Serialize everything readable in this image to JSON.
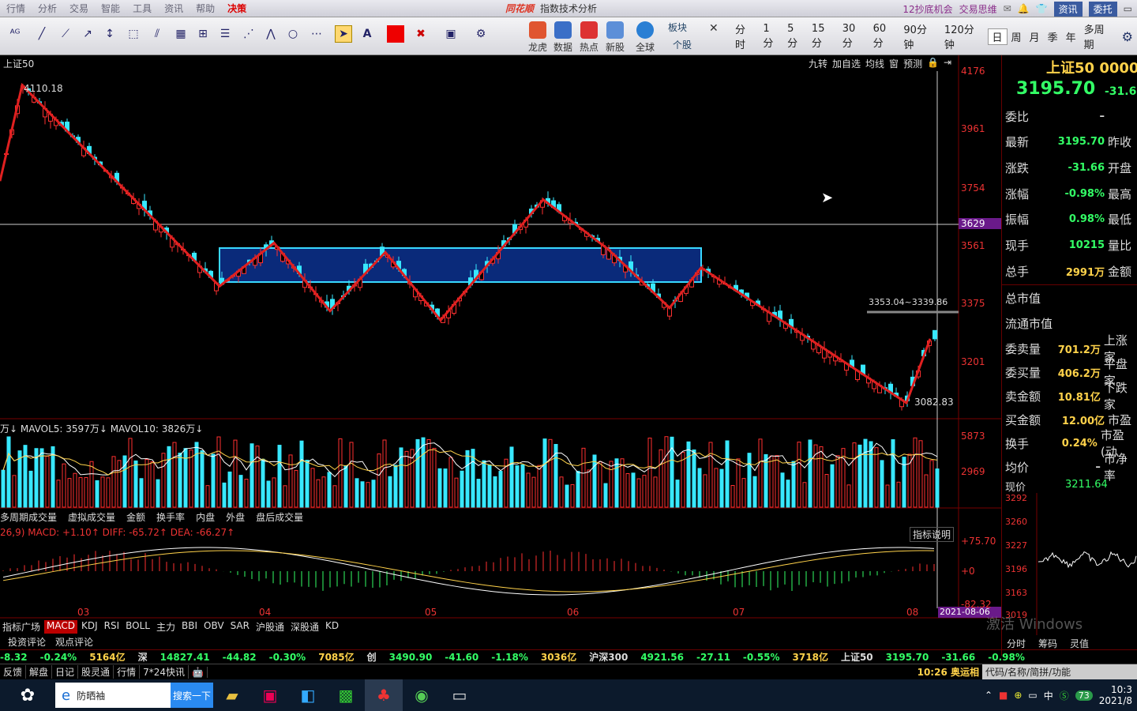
{
  "menu": {
    "items": [
      "行情",
      "分析",
      "交易",
      "智能",
      "工具",
      "资讯",
      "帮助",
      "决策"
    ]
  },
  "app": {
    "brand": "同花顺",
    "title": "指数技术分析"
  },
  "top_links": {
    "l1": "12抄底机会",
    "l2": "交易思维",
    "p1": "资讯",
    "p2": "委托"
  },
  "toolbar": {
    "buttons": [
      "龙虎",
      "数据",
      "热点",
      "新股",
      "全球"
    ],
    "board": "板块",
    "stock": "个股"
  },
  "periods": [
    "分时",
    "1分",
    "5分",
    "15分",
    "30分",
    "60分",
    "90分钟",
    "120分钟",
    "日",
    "周",
    "月",
    "季",
    "年",
    "多周期"
  ],
  "chart": {
    "title": "上证50",
    "toprighttabs": [
      "九转",
      "加自选",
      "均线",
      "窗",
      "预测"
    ],
    "y_labels": [
      "4176",
      "3961",
      "3754",
      "3629",
      "3561",
      "3375",
      "3201"
    ],
    "high_label": "4110.18",
    "low_label": "3082.83",
    "range_label": "3353.04~3339.86",
    "vol_title": "万↓ MAVOL5: 3597万↓ MAVOL10: 3826万↓",
    "vol_ticks": [
      "5873",
      "2969"
    ],
    "vol_tabs": [
      "多周期成交量",
      "虚拟成交量",
      "金额",
      "换手率",
      "内盘",
      "外盘",
      "盘后成交量"
    ],
    "macd_title": "26,9) MACD: +1.10↑ DIFF: -65.72↑ DEA: -66.27↑",
    "macd_ticks": [
      "+75.70",
      "+0",
      "-82.32"
    ],
    "macd_help": "指标说明",
    "months": [
      "03",
      "04",
      "05",
      "06",
      "07",
      "08"
    ],
    "date_tag": "2021-08-06",
    "ind_tabs": [
      "指标广场",
      "MACD",
      "KDJ",
      "RSI",
      "BOLL",
      "主力",
      "BBI",
      "OBV",
      "SAR",
      "沪股通",
      "深股通",
      "KD"
    ],
    "comment_tabs": [
      "投资评论",
      "观点评论"
    ]
  },
  "chart_data": {
    "type": "candlestick",
    "title": "上证50",
    "annotations": {
      "high": 4110.18,
      "low": 3082.83,
      "range_box": "3353.04~3339.86",
      "crosshair_price": 3629
    },
    "ylim": [
      3082.83,
      4176
    ],
    "x_months": [
      "03",
      "04",
      "05",
      "06",
      "07",
      "08"
    ],
    "volume": {
      "MAVOL5": "3597万",
      "MAVOL10": "3826万",
      "ticks": [
        5873,
        2969
      ]
    },
    "macd": {
      "MACD": 1.1,
      "DIFF": -65.72,
      "DEA": -66.27,
      "ticks": [
        75.7,
        0,
        -82.32
      ]
    }
  },
  "panel": {
    "name": "上证50 0000",
    "price": "3195.70",
    "chg": "-31.6",
    "rows": [
      {
        "k": "委比",
        "v": "–",
        "k2": ""
      },
      {
        "k": "最新",
        "v": "3195.70",
        "k2": "昨收"
      },
      {
        "k": "涨跌",
        "v": "-31.66",
        "k2": "开盘"
      },
      {
        "k": "涨幅",
        "v": "-0.98%",
        "k2": "最高"
      },
      {
        "k": "振幅",
        "v": "0.98%",
        "k2": "最低"
      },
      {
        "k": "现手",
        "v": "10215",
        "k2": "量比"
      },
      {
        "k": "总手",
        "v": "2991万",
        "k2": "金额"
      }
    ],
    "rows2": [
      {
        "k": "总市值",
        "v": "",
        "k2": ""
      },
      {
        "k": "流通市值",
        "v": "",
        "k2": ""
      },
      {
        "k": "委卖量",
        "v": "701.2万",
        "k2": "上涨家"
      },
      {
        "k": "委买量",
        "v": "406.2万",
        "k2": "平盘家"
      },
      {
        "k": "卖金额",
        "v": "10.81亿",
        "k2": "下跌家"
      },
      {
        "k": "买金额",
        "v": "12.00亿",
        "k2": "市盈"
      },
      {
        "k": "换手",
        "v": "0.24%",
        "k2": "市盈(动"
      },
      {
        "k": "均价",
        "v": "–",
        "k2": "市净率"
      }
    ],
    "now_label": "现价",
    "now_val": "3211.64",
    "mini_ticks": [
      "3292",
      "3260",
      "3227",
      "3196",
      "3163",
      "3019"
    ],
    "mini_tabs": [
      "分时",
      "筹码",
      "灵值"
    ],
    "watermark": "激活 Windows"
  },
  "ticker": {
    "items": [
      "-8.32",
      "-0.24%",
      "5164亿",
      "深",
      "14827.41",
      "-44.82",
      "-0.30%",
      "7085亿",
      "创",
      "3490.90",
      "-41.60",
      "-1.18%",
      "3036亿",
      "沪深300",
      "4921.56",
      "-27.11",
      "-0.55%",
      "3718亿",
      "上证50",
      "3195.70",
      "-31.66",
      "-0.98%"
    ]
  },
  "status": {
    "items": [
      "反馈",
      "解盘",
      "日记",
      "股灵通",
      "行情",
      "7*24快讯"
    ],
    "time": "10:26 奥运相",
    "search": "代码/名称/简拼/功能"
  },
  "taskbar": {
    "search_value": "防晒袖",
    "search_btn": "搜索一下",
    "clock": "10:3",
    "date": "2021/8",
    "badge": "73",
    "ime": "中"
  }
}
